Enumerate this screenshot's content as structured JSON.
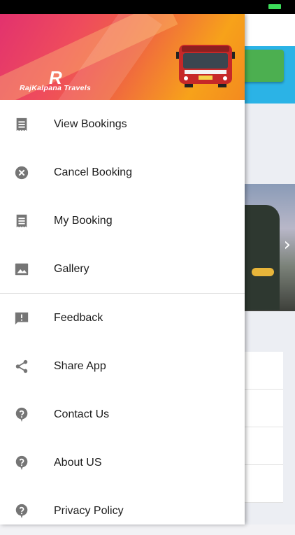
{
  "drawer": {
    "brand": "RajKalpana Travels",
    "logo_letter": "R",
    "items_top": [
      {
        "label": "View Bookings",
        "icon": "receipt-icon"
      },
      {
        "label": "Cancel Booking",
        "icon": "cancel-icon"
      },
      {
        "label": "My Booking",
        "icon": "receipt-icon"
      },
      {
        "label": "Gallery",
        "icon": "image-icon"
      }
    ],
    "items_bottom": [
      {
        "label": "Feedback",
        "icon": "feedback-icon"
      },
      {
        "label": "Share App",
        "icon": "share-icon"
      },
      {
        "label": "Contact Us",
        "icon": "help-bubble-icon"
      },
      {
        "label": "About US",
        "icon": "help-bubble-icon"
      },
      {
        "label": "Privacy Policy",
        "icon": "help-bubble-icon"
      }
    ]
  },
  "colors": {
    "icon_gray": "#757575",
    "status_battery": "#3ddc5a",
    "bg_accent_blue": "#2bb3e6",
    "bg_accent_green": "#4caf50"
  }
}
